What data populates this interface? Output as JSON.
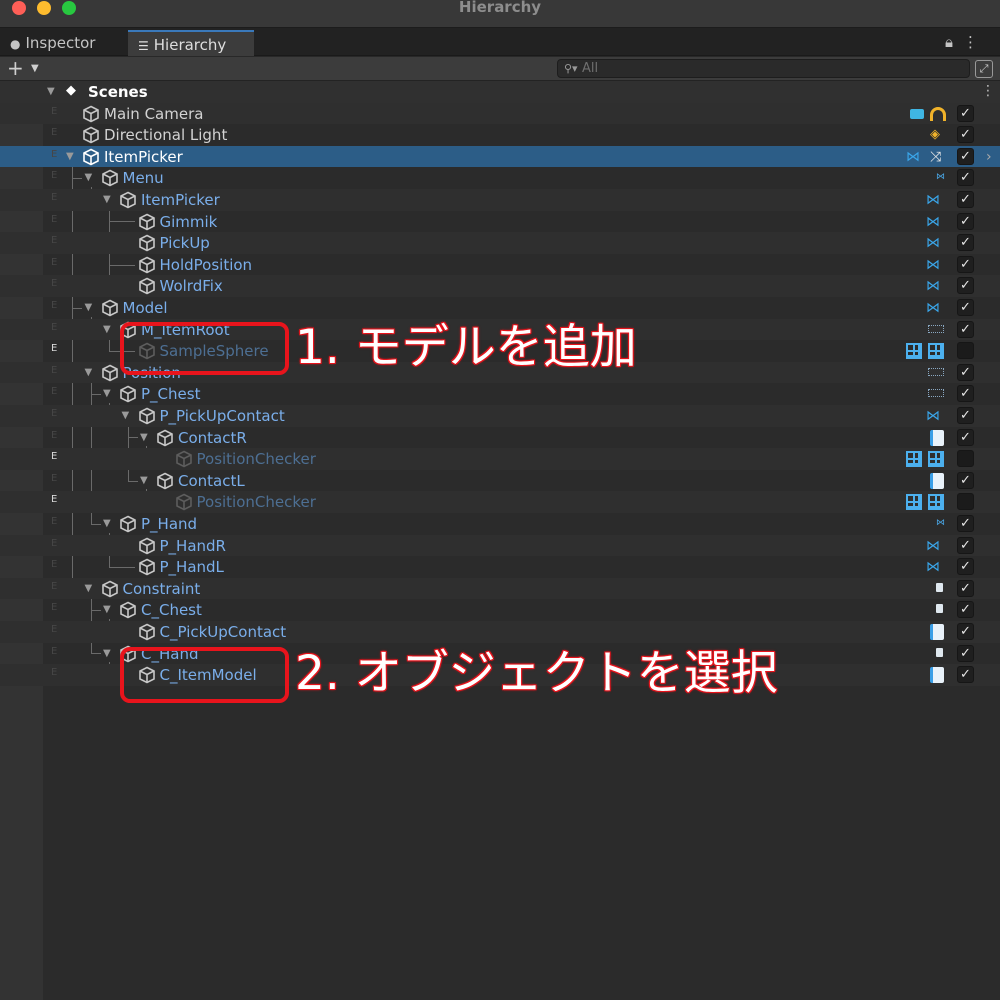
{
  "window": {
    "title": "Hierarchy"
  },
  "tabs": [
    {
      "label": "Inspector",
      "icon": "info-icon"
    },
    {
      "label": "Hierarchy",
      "icon": "list-icon",
      "active": true
    }
  ],
  "toolbar": {
    "add_label": "+",
    "search_placeholder": "All"
  },
  "scene": {
    "label": "Scenes"
  },
  "rows": [
    {
      "name": "Main Camera",
      "style": "normal",
      "checked": true,
      "icons": [
        "camera-icon",
        "headphones-icon"
      ]
    },
    {
      "name": "Directional Light",
      "style": "normal",
      "checked": true,
      "icons": [
        "light-icon"
      ]
    },
    {
      "name": "ItemPicker",
      "style": "selected",
      "checked": true,
      "icons": [
        "constraint-icon",
        "split-arrow-icon"
      ]
    },
    {
      "name": "Menu",
      "style": "blue",
      "checked": true,
      "icons": [
        "constraint-small-icon"
      ]
    },
    {
      "name": "ItemPicker",
      "style": "blue",
      "checked": true,
      "icons": [
        "constraint-icon"
      ]
    },
    {
      "name": "Gimmik",
      "style": "blue",
      "checked": true,
      "icons": [
        "constraint-icon"
      ]
    },
    {
      "name": "PickUp",
      "style": "blue",
      "checked": true,
      "icons": [
        "constraint-icon"
      ]
    },
    {
      "name": "HoldPosition",
      "style": "blue",
      "checked": true,
      "icons": [
        "constraint-icon"
      ]
    },
    {
      "name": "WolrdFix",
      "style": "blue",
      "checked": true,
      "icons": [
        "constraint-icon"
      ]
    },
    {
      "name": "Model",
      "style": "blue",
      "checked": true,
      "icons": [
        "constraint-icon"
      ]
    },
    {
      "name": "M_ItemRoot",
      "style": "blue",
      "checked": true,
      "icons": [
        "component-small-icon"
      ]
    },
    {
      "name": "SampleSphere",
      "style": "dim",
      "checked": false,
      "icons": [
        "grid-icon",
        "grid-eye-icon"
      ]
    },
    {
      "name": "Position",
      "style": "blue",
      "checked": true,
      "icons": [
        "component-small-icon"
      ]
    },
    {
      "name": "P_Chest",
      "style": "blue",
      "checked": true,
      "icons": [
        "component-small-icon"
      ]
    },
    {
      "name": "P_PickUpContact",
      "style": "blue",
      "checked": true,
      "icons": [
        "constraint-icon"
      ]
    },
    {
      "name": "ContactR",
      "style": "blue",
      "checked": true,
      "icons": [
        "script-icon"
      ]
    },
    {
      "name": "PositionChecker",
      "style": "dim",
      "checked": false,
      "icons": [
        "grid-icon",
        "grid-eye-icon"
      ]
    },
    {
      "name": "ContactL",
      "style": "blue",
      "checked": true,
      "icons": [
        "script-icon"
      ]
    },
    {
      "name": "PositionChecker",
      "style": "dim",
      "checked": false,
      "icons": [
        "grid-icon",
        "grid-eye-icon"
      ]
    },
    {
      "name": "P_Hand",
      "style": "blue",
      "checked": true,
      "icons": [
        "constraint-small-icon"
      ]
    },
    {
      "name": "P_HandR",
      "style": "blue",
      "checked": true,
      "icons": [
        "constraint-icon"
      ]
    },
    {
      "name": "P_HandL",
      "style": "blue",
      "checked": true,
      "icons": [
        "constraint-icon"
      ]
    },
    {
      "name": "Constraint",
      "style": "blue",
      "checked": true,
      "icons": [
        "doc-icon"
      ]
    },
    {
      "name": "C_Chest",
      "style": "blue",
      "checked": true,
      "icons": [
        "doc-icon"
      ]
    },
    {
      "name": "C_PickUpContact",
      "style": "blue",
      "checked": true,
      "icons": [
        "script-icon"
      ]
    },
    {
      "name": "C_Hand",
      "style": "blue",
      "checked": true,
      "icons": [
        "doc-icon"
      ]
    },
    {
      "name": "C_ItemModel",
      "style": "blue",
      "checked": true,
      "icons": [
        "script-icon"
      ]
    }
  ],
  "annotations": [
    {
      "text": "1. モデルを追加"
    },
    {
      "text": "2. オブジェクトを選択"
    }
  ],
  "colors": {
    "selection": "#2c5d87",
    "accent_blue": "#7aaeea",
    "annotation_red": "#e8141c",
    "tab_underline": "#3a79bb"
  }
}
